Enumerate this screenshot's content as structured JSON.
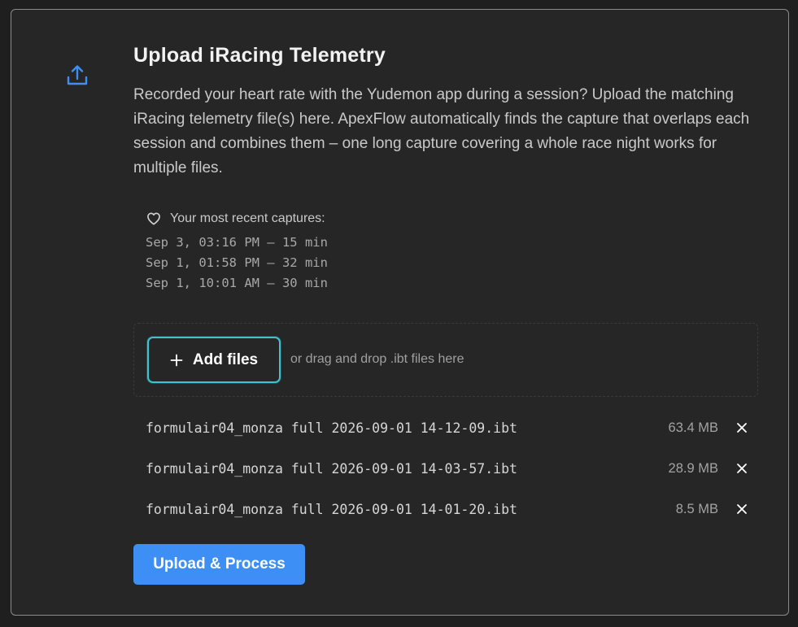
{
  "colors": {
    "accent_blue": "#3d8ff5",
    "accent_teal": "#3cc3cf",
    "background": "#262626",
    "border": "#8a8a8a"
  },
  "icons": {
    "upload": "upload-icon",
    "heart": "heart-icon",
    "plus": "plus-icon",
    "remove": "close-icon"
  },
  "panel": {
    "title": "Upload iRacing Telemetry",
    "description": "Recorded your heart rate with the Yudemon app during a session? Upload the matching iRacing telemetry file(s) here. ApexFlow automatically finds the capture that overlaps each session and combines them – one long capture covering a whole race night works for multiple files."
  },
  "captures": {
    "header": "Your most recent captures:",
    "items": [
      "Sep 3, 03:16 PM – 15 min",
      "Sep 1, 01:58 PM – 32 min",
      "Sep 1, 10:01 AM – 30 min"
    ]
  },
  "dropzone": {
    "add_label": "Add files",
    "hint": "or drag and drop .ibt files here"
  },
  "files": [
    {
      "name": "formulair04_monza full 2026-09-01 14-12-09.ibt",
      "size": "63.4 MB"
    },
    {
      "name": "formulair04_monza full 2026-09-01 14-03-57.ibt",
      "size": "28.9 MB"
    },
    {
      "name": "formulair04_monza full 2026-09-01 14-01-20.ibt",
      "size": "8.5 MB"
    }
  ],
  "actions": {
    "upload_label": "Upload & Process"
  }
}
